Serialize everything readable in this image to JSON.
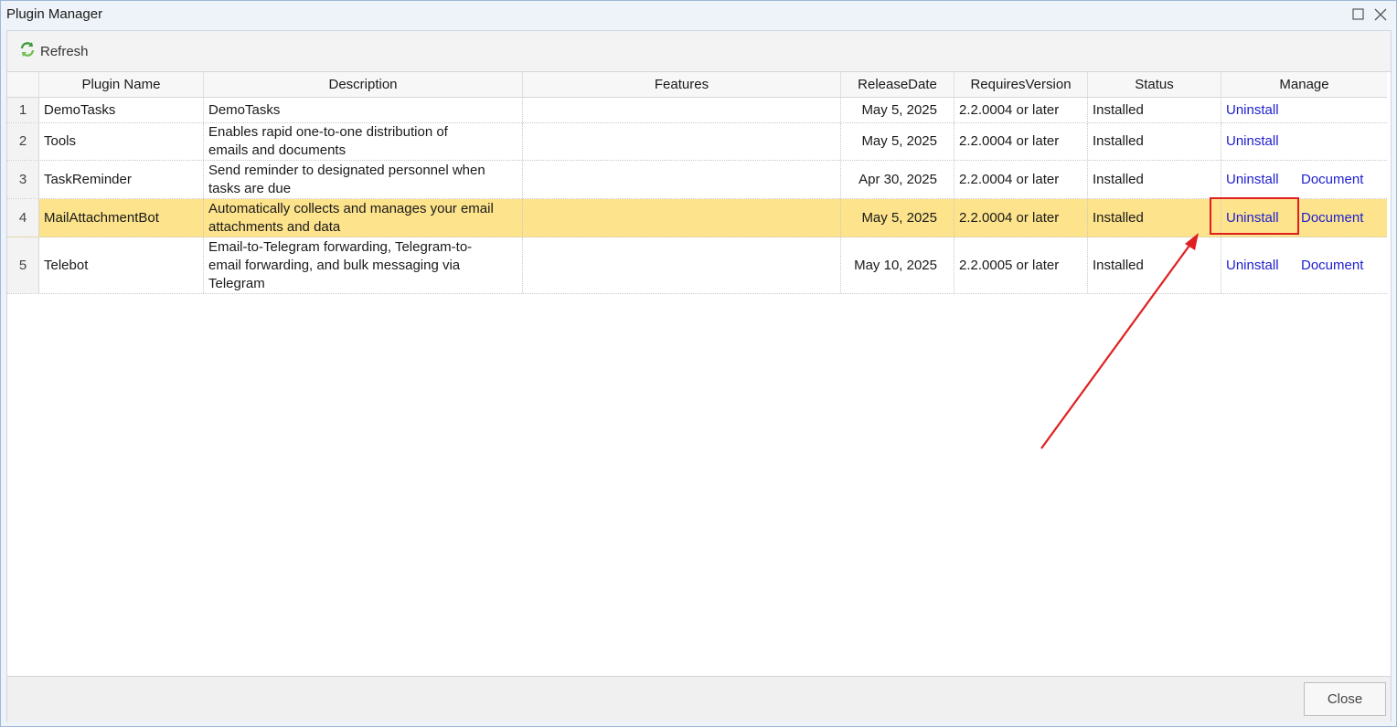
{
  "window": {
    "title": "Plugin Manager"
  },
  "toolbar": {
    "refresh_label": "Refresh",
    "refresh_icon": "refresh-icon"
  },
  "table": {
    "headers": [
      "Plugin Name",
      "Description",
      "Features",
      "ReleaseDate",
      "RequiresVersion",
      "Status",
      "Manage"
    ],
    "rows": [
      {
        "num": "1",
        "name": "DemoTasks",
        "desc": [
          "DemoTasks"
        ],
        "features": "",
        "release": "May 5, 2025",
        "requires": "2.2.0004 or later",
        "status": "Installed",
        "uninstall": "Uninstall",
        "document": ""
      },
      {
        "num": "2",
        "name": "Tools",
        "desc": [
          "Enables rapid one-to-one distribution of",
          "emails and documents"
        ],
        "features": "",
        "release": "May 5, 2025",
        "requires": "2.2.0004 or later",
        "status": "Installed",
        "uninstall": "Uninstall",
        "document": ""
      },
      {
        "num": "3",
        "name": "TaskReminder",
        "desc": [
          "Send reminder to designated personnel when",
          "tasks are due"
        ],
        "features": "",
        "release": "Apr 30, 2025",
        "requires": "2.2.0004 or later",
        "status": "Installed",
        "uninstall": "Uninstall",
        "document": "Document"
      },
      {
        "num": "4",
        "name": "MailAttachmentBot",
        "desc": [
          "Automatically collects and manages your email",
          "attachments and data"
        ],
        "features": "",
        "release": "May 5, 2025",
        "requires": "2.2.0004 or later",
        "status": "Installed",
        "uninstall": "Uninstall",
        "document": "Document"
      },
      {
        "num": "5",
        "name": "Telebot",
        "desc": [
          "Email-to-Telegram forwarding, Telegram-to-",
          "email forwarding, and bulk messaging via",
          "Telegram"
        ],
        "features": "",
        "release": "May 10, 2025",
        "requires": "2.2.0005 or later",
        "status": "Installed",
        "uninstall": "Uninstall",
        "document": "Document"
      }
    ],
    "selected_row": "4"
  },
  "footer": {
    "close_label": "Close"
  },
  "colors": {
    "selected_row": "#fde38b",
    "link": "#2020d0",
    "annotation": "#e02020"
  }
}
